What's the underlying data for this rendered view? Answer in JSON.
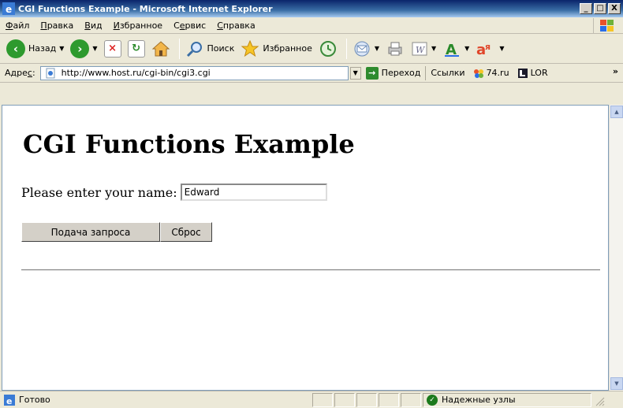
{
  "window": {
    "title": "CGI Functions Example - Microsoft Internet Explorer",
    "minimize": "_",
    "maximize": "□",
    "close": "X"
  },
  "menu": {
    "items": [
      {
        "accel": "Ф",
        "rest": "айл"
      },
      {
        "accel": "П",
        "rest": "равка"
      },
      {
        "accel": "В",
        "rest": "ид"
      },
      {
        "accel": "И",
        "rest": "збранное"
      },
      {
        "pre": "С",
        "accel": "е",
        "rest": "рвис"
      },
      {
        "accel": "С",
        "rest": "правка"
      }
    ]
  },
  "toolbar": {
    "back_label": "Назад",
    "search_label": "Поиск",
    "favorites_label": "Избранное"
  },
  "address": {
    "label_accel": "с",
    "label_pre": "Адре",
    "label_post": ":",
    "url": "http://www.host.ru/cgi-bin/cgi3.cgi",
    "go_label": "Переход",
    "links_label": "Ссылки",
    "link1": "74.ru",
    "link2": "LOR",
    "more": "»"
  },
  "page": {
    "heading": "CGI Functions Example",
    "prompt": "Please enter your name:",
    "name_value": "Edward",
    "submit_label": "Подача запроса",
    "reset_label": "Сброс"
  },
  "status": {
    "text": "Готово",
    "zone": "Надежные узлы"
  },
  "colors": {
    "titlebar": "#0a246a",
    "chrome": "#ece9d8",
    "go_green": "#2e8b2e"
  }
}
